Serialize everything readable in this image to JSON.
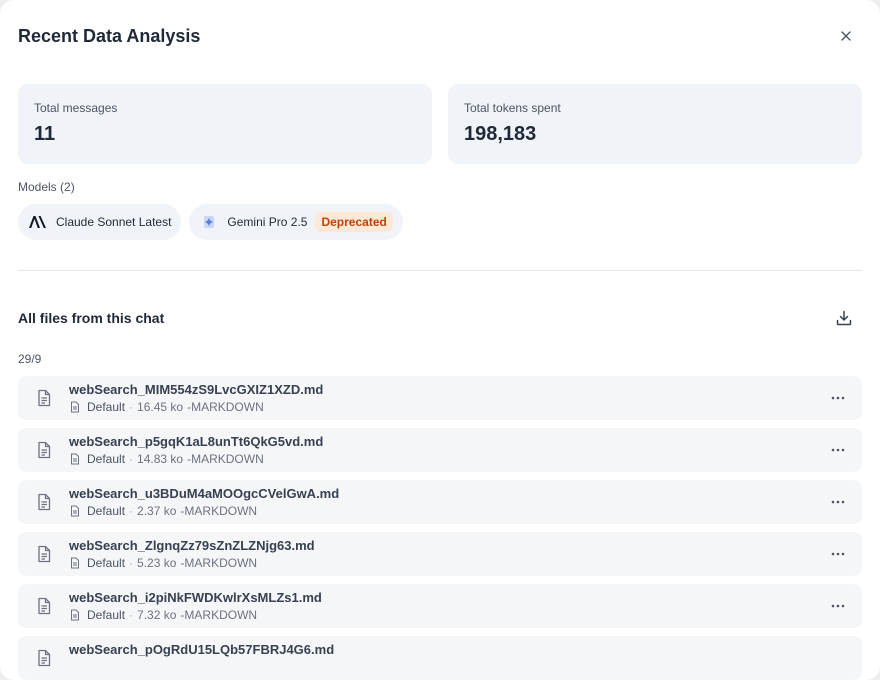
{
  "dialog": {
    "title": "Recent Data Analysis",
    "close_symbol": "×"
  },
  "stats": {
    "messages_label": "Total messages",
    "messages_value": "11",
    "tokens_label": "Total tokens spent",
    "tokens_value": "198,183"
  },
  "models": {
    "label": "Models (2)",
    "items": [
      {
        "name": "Claude Sonnet Latest",
        "icon": "anthropic-logo-icon"
      },
      {
        "name": "Gemini Pro 2.5",
        "icon": "gemini-logo-icon",
        "badge": "Deprecated"
      }
    ]
  },
  "files": {
    "title": "All files from this chat",
    "count": "29/9",
    "items": [
      {
        "name": "webSearch_MIM554zS9LvcGXIZ1XZD.md",
        "source": "Default",
        "size": "16.45 ko",
        "type": "-MARKDOWN"
      },
      {
        "name": "webSearch_p5gqK1aL8unTt6QkG5vd.md",
        "source": "Default",
        "size": "14.83 ko",
        "type": "-MARKDOWN"
      },
      {
        "name": "webSearch_u3BDuM4aMOOgcCVelGwA.md",
        "source": "Default",
        "size": "2.37 ko",
        "type": "-MARKDOWN"
      },
      {
        "name": "webSearch_ZlgnqZz79sZnZLZNjg63.md",
        "source": "Default",
        "size": "5.23 ko",
        "type": "-MARKDOWN"
      },
      {
        "name": "webSearch_i2piNkFWDKwlrXsMLZs1.md",
        "source": "Default",
        "size": "7.32 ko",
        "type": "-MARKDOWN"
      },
      {
        "name": "webSearch_pOgRdU15LQb57FBRJ4G6.md",
        "source": "",
        "size": "",
        "type": ""
      }
    ]
  },
  "colors": {
    "card_bg": "#f0f3f7",
    "row_bg": "#f5f6f8",
    "badge_bg": "#fde9d6",
    "badge_text": "#c2410c"
  }
}
